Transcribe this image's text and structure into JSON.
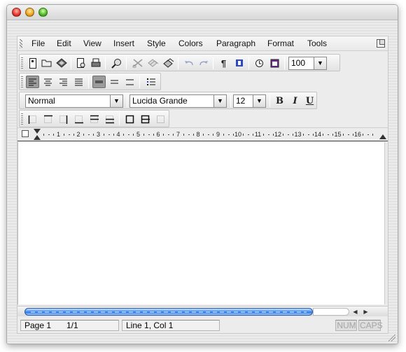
{
  "window": {
    "controls": [
      "close",
      "minimize",
      "zoom"
    ]
  },
  "menu": {
    "items": [
      "File",
      "Edit",
      "View",
      "Insert",
      "Style",
      "Colors",
      "Paragraph",
      "Format",
      "Tools"
    ]
  },
  "toolbar1": {
    "zoom": "100",
    "buttons": [
      "new-document-icon",
      "open-folder-icon",
      "save-icon",
      "print-preview-icon",
      "print-icon",
      "find-icon",
      "cut-icon",
      "copy-icon",
      "paste-icon",
      "undo-icon",
      "redo-icon",
      "pilcrow-icon",
      "field-icon",
      "clock-icon",
      "calendar-icon"
    ]
  },
  "toolbar2": {
    "buttons": [
      "align-left-icon",
      "align-center-icon",
      "align-right-icon",
      "justify-icon",
      "line-spacing-single-icon",
      "line-spacing-onehalf-icon",
      "line-spacing-double-icon",
      "bullet-list-icon"
    ]
  },
  "formatbar": {
    "style": "Normal",
    "font": "Lucida Grande",
    "size": "12",
    "bold": "B",
    "italic": "I",
    "underline": "U"
  },
  "borderbar": {
    "buttons": [
      "border-left-icon",
      "border-top-icon",
      "border-right-icon",
      "border-bottom-icon",
      "border-inside-horizontal-icon",
      "border-top-bottom-icon",
      "border-outside-icon",
      "border-all-icon",
      "border-none-icon"
    ]
  },
  "ruler": {
    "numbers": [
      "1",
      "2",
      "3",
      "4",
      "5",
      "6",
      "7",
      "8",
      "9",
      "10",
      "11",
      "12",
      "13",
      "14",
      "15",
      "16"
    ]
  },
  "status": {
    "page": "Page 1",
    "pages": "1/1",
    "position": "Line 1, Col 1",
    "num": "NUM",
    "caps": "CAPS"
  },
  "colors": {
    "scroll_thumb": "#2f79e0",
    "pressed_button": "#9b9b9b"
  }
}
